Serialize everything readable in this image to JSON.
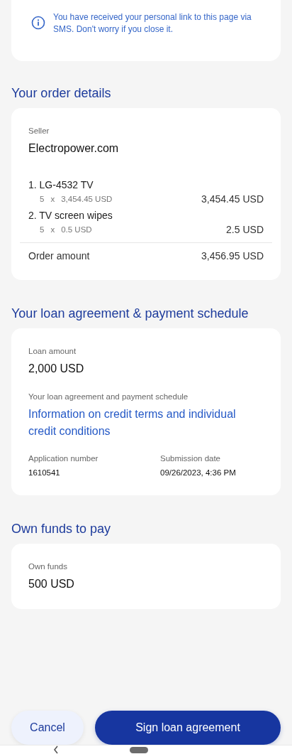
{
  "notice": {
    "text": "You have received your personal link to this page via SMS. Don't worry if you close it."
  },
  "order": {
    "title": "Your order details",
    "seller_label": "Seller",
    "seller": "Electropower.com",
    "items": [
      {
        "name": "1. LG-4532 TV",
        "quantity": "5",
        "times": "x",
        "unit_price": "3,454.45 USD",
        "total": "3,454.45 USD"
      },
      {
        "name": "2. TV screen wipes",
        "quantity": "5",
        "times": "x",
        "unit_price": "0.5 USD",
        "total": "2.5 USD"
      }
    ],
    "amount_label": "Order amount",
    "amount": "3,456.95 USD"
  },
  "loan": {
    "title": "Your loan agreement & payment schedule",
    "amount_label": "Loan amount",
    "amount": "2,000 USD",
    "agreement_label": "Your loan agreement and payment schedule",
    "agreement_link": "Information on credit terms and individual credit conditions",
    "application_label": "Application number",
    "application": "1610541",
    "date_label": "Submission date",
    "date": "09/26/2023, 4:36 PM"
  },
  "own_funds": {
    "title": "Own funds to pay",
    "label": "Own funds",
    "value": "500 USD"
  },
  "buttons": [
    {
      "label": "Cancel",
      "kind": "secondary"
    },
    {
      "label": "Sign loan agreement",
      "kind": "primary"
    }
  ]
}
